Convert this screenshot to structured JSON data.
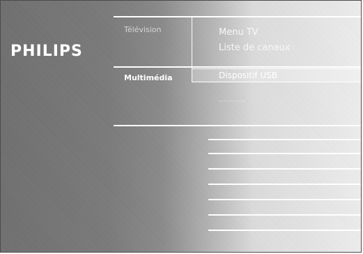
{
  "brand": {
    "logo_text": "PHILIPS"
  },
  "categories": {
    "television": "Télévision",
    "multimedia": "Multimédia"
  },
  "television_menu": {
    "items": [
      "Menu TV",
      "Liste de canaux"
    ]
  },
  "multimedia_menu": {
    "items": [
      "Dispositif USB"
    ],
    "selected_index": 0,
    "placeholder": "··········"
  },
  "colors": {
    "text": "#ffffff",
    "background_dark": "#6f6f6f",
    "background_light": "#f0f0f0"
  }
}
